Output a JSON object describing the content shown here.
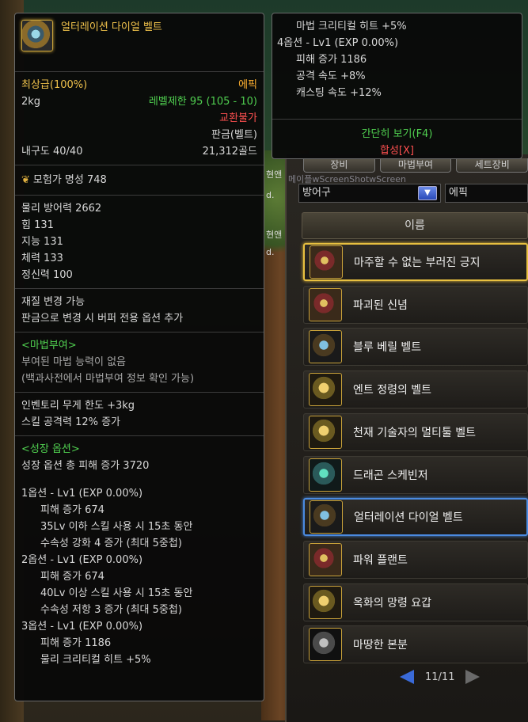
{
  "background": {
    "watermark": "메이플wScreenShotwScreen",
    "side_snippets": [
      "현앤",
      "d.",
      "현앤",
      "d."
    ]
  },
  "tooltip": {
    "item_name": "얼터레이션 다이얼 벨트",
    "grade_label": "최상급",
    "grade_pct": "(100%)",
    "rarity": "에픽",
    "weight": "2kg",
    "level_req": "레벨제한 95 (105 - 10)",
    "trade": "교환불가",
    "type": "판금(벨트)",
    "durability": "내구도 40/40",
    "price": "21,312골드",
    "fame": "모험가 명성 748",
    "stats": [
      "물리 방어력 2662",
      "힘 131",
      "지능 131",
      "체력 133",
      "정신력 100"
    ],
    "material_change": [
      "재질 변경 가능",
      "판금으로 변경 시 버퍼 전용 옵션 추가"
    ],
    "enchant_title": "<마법부여>",
    "enchant_lines": [
      "부여된 마법 능력이 없음",
      "(백과사전에서 마법부여 정보 확인 가능)"
    ],
    "effects": [
      "인벤토리 무게 한도 +3kg",
      "스킬 공격력 12% 증가"
    ],
    "growth_title": "<성장 옵션>",
    "growth_total": "성장 옵션 총 피해 증가 3720",
    "options": [
      {
        "header": "1옵션 - Lv1 (EXP 0.00%)",
        "lines": [
          "피해 증가 674",
          "35Lv 이하 스킬 사용 시 15초 동안",
          "수속성 강화 4 증가 (최대 5중첩)"
        ]
      },
      {
        "header": "2옵션 - Lv1 (EXP 0.00%)",
        "lines": [
          "피해 증가 674",
          "40Lv 이상 스킬 사용 시 15초 동안",
          "수속성 저항 3 증가 (최대 5중첩)"
        ]
      },
      {
        "header": "3옵션 - Lv1 (EXP 0.00%)",
        "lines": [
          "피해 증가 1186",
          "물리 크리티컬 히트 +5%"
        ]
      }
    ],
    "continued": {
      "first_line": "마법 크리티컬 히트 +5%",
      "option4_header": "4옵션 - Lv1 (EXP 0.00%)",
      "option4_lines": [
        "피해 증가 1186",
        "공격 속도 +8%",
        "캐스팅 속도 +12%"
      ],
      "brief_view": "간단히 보기(F4)",
      "combine": "합성[X]"
    }
  },
  "list_window": {
    "tabs": [
      "장비",
      "마법부여",
      "세트장비"
    ],
    "category": "방어구",
    "rarity_filter": "에픽",
    "column_header": "이름",
    "items": [
      {
        "name": "마주할 수 없는 부러진 긍지",
        "state": "selected",
        "icon": "a"
      },
      {
        "name": "파괴된 신념",
        "state": "normal",
        "icon": "a"
      },
      {
        "name": "블루 베릴 벨트",
        "state": "normal",
        "icon": "b"
      },
      {
        "name": "엔트 정령의 벨트",
        "state": "normal",
        "icon": "c"
      },
      {
        "name": "천재 기술자의 멀티툴 벨트",
        "state": "normal",
        "icon": "c"
      },
      {
        "name": "드래곤 스케빈저",
        "state": "normal",
        "icon": "d"
      },
      {
        "name": "얼터레이션 다이얼 벨트",
        "state": "current",
        "icon": "b"
      },
      {
        "name": "파워 플랜트",
        "state": "normal",
        "icon": "a"
      },
      {
        "name": "옥화의 망령 요갑",
        "state": "normal",
        "icon": "c"
      },
      {
        "name": "마땅한 본분",
        "state": "normal",
        "icon": "e"
      }
    ],
    "page": "11/11"
  }
}
